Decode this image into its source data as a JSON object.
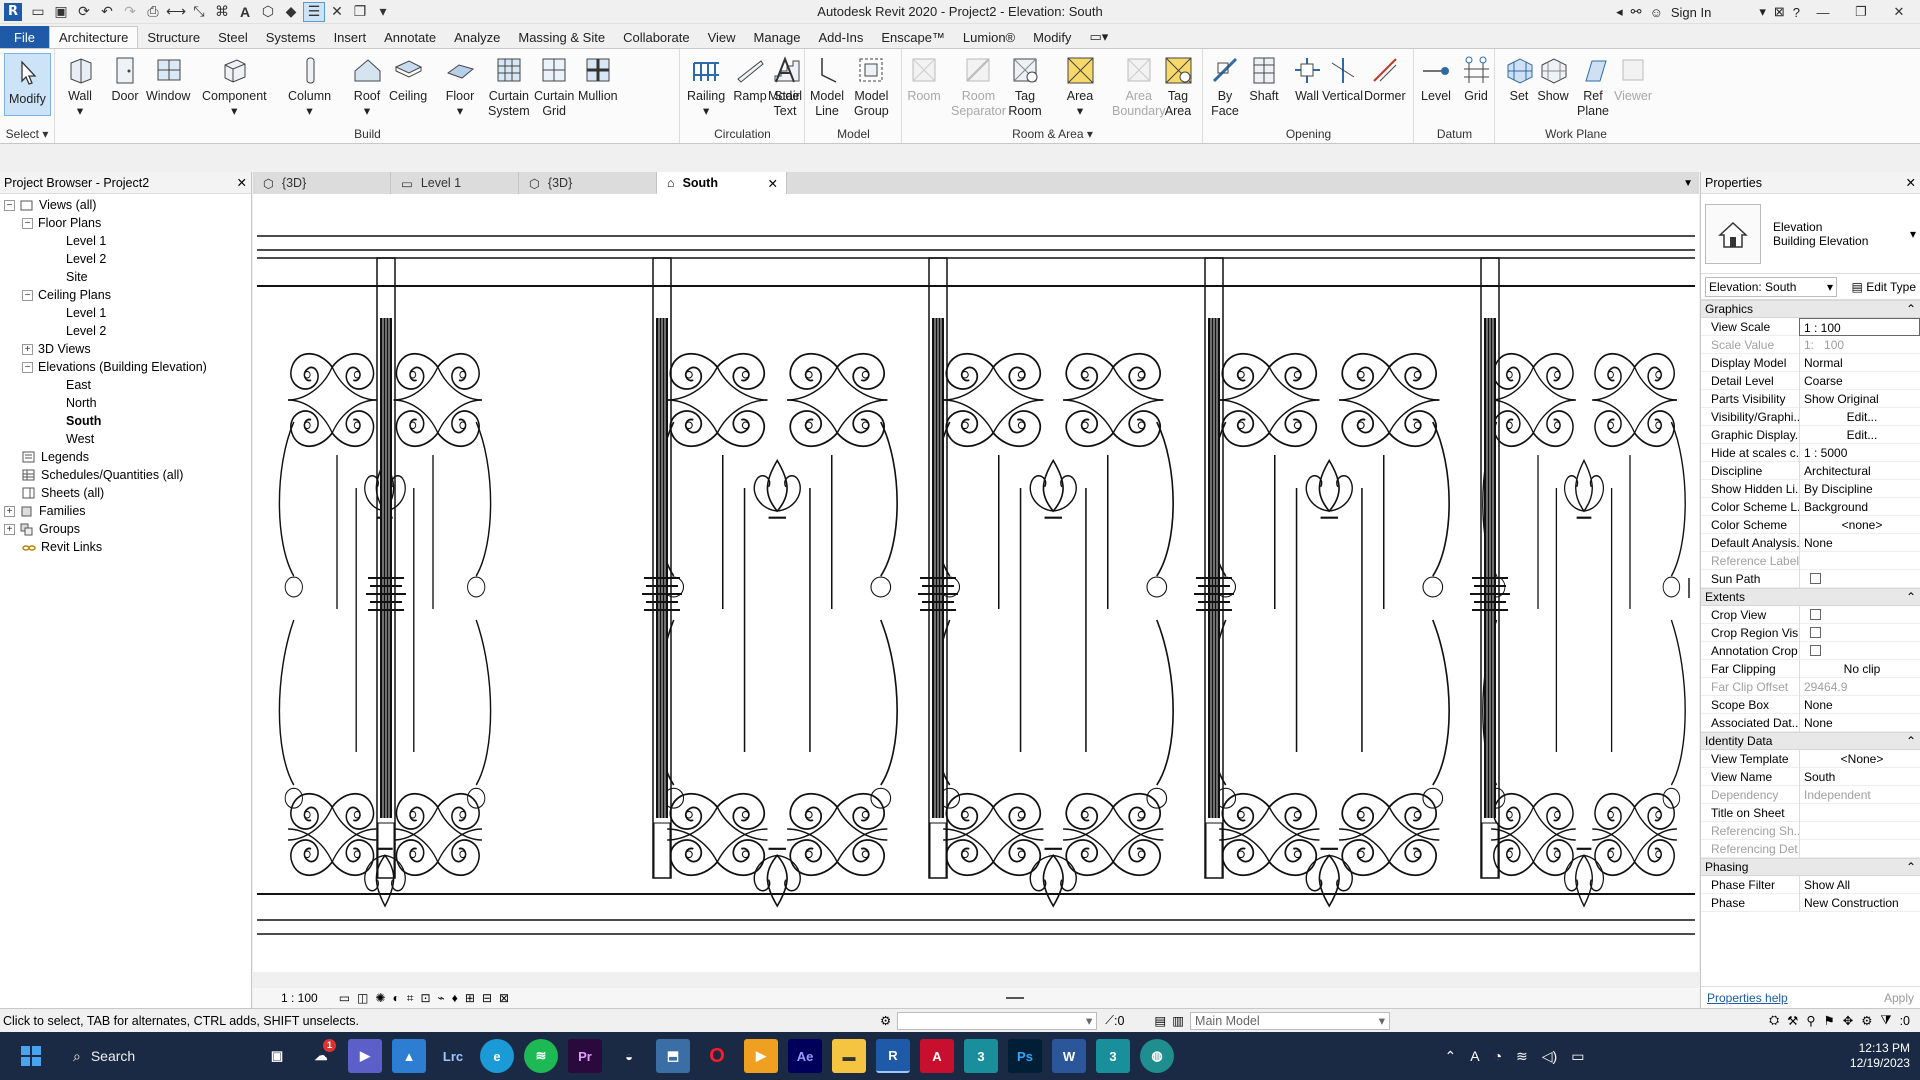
{
  "window": {
    "title": "Autodesk Revit 2020 - Project2 - Elevation: South",
    "sign_in": "Sign In"
  },
  "ribbon_tabs": [
    "File",
    "Architecture",
    "Structure",
    "Steel",
    "Systems",
    "Insert",
    "Annotate",
    "Analyze",
    "Massing & Site",
    "Collaborate",
    "View",
    "Manage",
    "Add-Ins",
    "Enscape™",
    "Lumion®",
    "Modify"
  ],
  "select_label": "Select",
  "panels": {
    "build": "Build",
    "circulation": "Circulation",
    "model": "Model",
    "room_area": "Room & Area",
    "opening": "Opening",
    "datum": "Datum",
    "work_plane": "Work Plane"
  },
  "tools": {
    "modify": "Modify",
    "wall": "Wall",
    "door": "Door",
    "window": "Window",
    "component": "Component",
    "column": "Column",
    "roof": "Roof",
    "ceiling": "Ceiling",
    "floor": "Floor",
    "curtain_system_1": "Curtain",
    "curtain_system_2": "System",
    "curtain_grid_1": "Curtain",
    "curtain_grid_2": "Grid",
    "mullion": "Mullion",
    "railing": "Railing",
    "ramp": "Ramp",
    "stair": "Stair",
    "model_text_1": "Model",
    "model_text_2": "Text",
    "model_line_1": "Model",
    "model_line_2": "Line",
    "model_group_1": "Model",
    "model_group_2": "Group",
    "room": "Room",
    "room_sep_1": "Room",
    "room_sep_2": "Separator",
    "tag_room_1": "Tag",
    "tag_room_2": "Room",
    "area": "Area",
    "area_boundary_1": "Area",
    "area_boundary_2": "Boundary",
    "tag_area_1": "Tag",
    "tag_area_2": "Area",
    "by_face_1": "By",
    "by_face_2": "Face",
    "shaft": "Shaft",
    "wall_opening": "Wall",
    "vertical": "Vertical",
    "dormer": "Dormer",
    "level": "Level",
    "grid": "Grid",
    "set": "Set",
    "show": "Show",
    "ref_plane_1": "Ref",
    "ref_plane_2": "Plane",
    "viewer": "Viewer"
  },
  "browser": {
    "title": "Project Browser - Project2",
    "items": [
      "Views (all)",
      "Floor Plans",
      "Level 1",
      "Level 2",
      "Site",
      "Ceiling Plans",
      "Level 1",
      "Level 2",
      "3D Views",
      "Elevations (Building Elevation)",
      "East",
      "North",
      "South",
      "West",
      "Legends",
      "Schedules/Quantities (all)",
      "Sheets (all)",
      "Families",
      "Groups",
      "Revit Links"
    ]
  },
  "view_tabs": [
    "{3D}",
    "Level 1",
    "{3D}",
    "South"
  ],
  "view_control": {
    "scale": "1 : 100"
  },
  "properties": {
    "title": "Properties",
    "type_1": "Elevation",
    "type_2": "Building Elevation",
    "selector": "Elevation: South",
    "edit_type": "Edit Type",
    "sections": {
      "graphics": "Graphics",
      "extents": "Extents",
      "identity": "Identity Data",
      "phasing": "Phasing"
    },
    "graphics": [
      {
        "k": "View Scale",
        "v": "1 : 100"
      },
      {
        "k": "Scale Value",
        "v": "100"
      },
      {
        "k": "Display Model",
        "v": "Normal"
      },
      {
        "k": "Detail Level",
        "v": "Coarse"
      },
      {
        "k": "Parts Visibility",
        "v": "Show Original"
      },
      {
        "k": "Visibility/Graphi...",
        "v": "Edit..."
      },
      {
        "k": "Graphic Display...",
        "v": "Edit..."
      },
      {
        "k": "Hide at scales c...",
        "v": "1 : 5000"
      },
      {
        "k": "Discipline",
        "v": "Architectural"
      },
      {
        "k": "Show Hidden Li...",
        "v": "By Discipline"
      },
      {
        "k": "Color Scheme L...",
        "v": "Background"
      },
      {
        "k": "Color Scheme",
        "v": "<none>"
      },
      {
        "k": "Default Analysis...",
        "v": "None"
      },
      {
        "k": "Reference Label",
        "v": ""
      },
      {
        "k": "Sun Path",
        "v": ""
      }
    ],
    "scale_value_prefix": "1:",
    "extents": [
      {
        "k": "Crop View",
        "v": ""
      },
      {
        "k": "Crop Region Vis...",
        "v": ""
      },
      {
        "k": "Annotation Crop",
        "v": ""
      },
      {
        "k": "Far Clipping",
        "v": "No clip"
      },
      {
        "k": "Far Clip Offset",
        "v": "29464.9"
      },
      {
        "k": "Scope Box",
        "v": "None"
      },
      {
        "k": "Associated Dat...",
        "v": "None"
      }
    ],
    "identity": [
      {
        "k": "View Template",
        "v": "<None>"
      },
      {
        "k": "View Name",
        "v": "South"
      },
      {
        "k": "Dependency",
        "v": "Independent"
      },
      {
        "k": "Title on Sheet",
        "v": ""
      },
      {
        "k": "Referencing Sh...",
        "v": ""
      },
      {
        "k": "Referencing Det...",
        "v": ""
      }
    ],
    "phasing": [
      {
        "k": "Phase Filter",
        "v": "Show All"
      },
      {
        "k": "Phase",
        "v": "New Construction"
      }
    ],
    "help": "Properties help",
    "apply": "Apply"
  },
  "status": {
    "message": "Click to select, TAB for alternates, CTRL adds, SHIFT unselects.",
    "workset_count": ":0",
    "model": "Main Model",
    "filter_count": ":0"
  },
  "taskbar": {
    "search": "Search",
    "time": "12:13 PM",
    "date": "12/19/2023",
    "badge": "1"
  },
  "colors": {
    "accent": "#1e5aa8",
    "taskbar": "#1b2a44",
    "selection": "#cde3f8"
  }
}
